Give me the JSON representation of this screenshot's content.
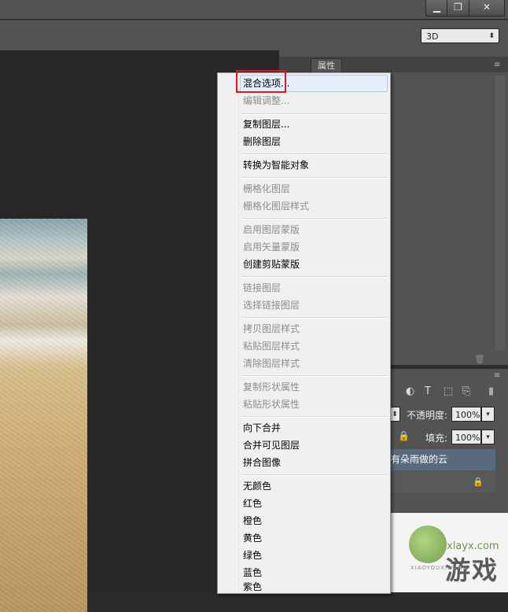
{
  "options": {
    "mode_3d": "3D"
  },
  "properties_panel": {
    "tab_label": "属性"
  },
  "layers_panel": {
    "opacity_label": "不透明度:",
    "opacity_value": "100%",
    "fill_label": "填充:",
    "fill_value": "100%",
    "layer_name": "有朵雨做的云"
  },
  "context_menu": {
    "items": [
      {
        "label": "混合选项...",
        "enabled": true,
        "highlighted": true
      },
      {
        "label": "编辑调整...",
        "enabled": false
      },
      {
        "label": "复制图层...",
        "enabled": true
      },
      {
        "label": "删除图层",
        "enabled": true
      },
      {
        "label": "转换为智能对象",
        "enabled": true
      },
      {
        "label": "栅格化图层",
        "enabled": false
      },
      {
        "label": "栅格化图层样式",
        "enabled": false
      },
      {
        "label": "启用图层蒙版",
        "enabled": false
      },
      {
        "label": "启用矢量蒙版",
        "enabled": false
      },
      {
        "label": "创建剪贴蒙版",
        "enabled": true
      },
      {
        "label": "链接图层",
        "enabled": false
      },
      {
        "label": "选择链接图层",
        "enabled": false
      },
      {
        "label": "拷贝图层样式",
        "enabled": false
      },
      {
        "label": "粘贴图层样式",
        "enabled": false
      },
      {
        "label": "清除图层样式",
        "enabled": false
      },
      {
        "label": "复制形状属性",
        "enabled": false
      },
      {
        "label": "粘贴形状属性",
        "enabled": false
      },
      {
        "label": "向下合并",
        "enabled": true
      },
      {
        "label": "合并可见图层",
        "enabled": true
      },
      {
        "label": "拼合图像",
        "enabled": true
      },
      {
        "label": "无颜色",
        "enabled": true
      },
      {
        "label": "红色",
        "enabled": true
      },
      {
        "label": "橙色",
        "enabled": true
      },
      {
        "label": "黄色",
        "enabled": true
      },
      {
        "label": "绿色",
        "enabled": true
      },
      {
        "label": "蓝色",
        "enabled": true
      },
      {
        "label": "紫色",
        "enabled": true
      }
    ]
  },
  "watermark": {
    "url": "xlayx.com",
    "text": "游戏",
    "sub": "XIAOYOUXIWANG"
  }
}
